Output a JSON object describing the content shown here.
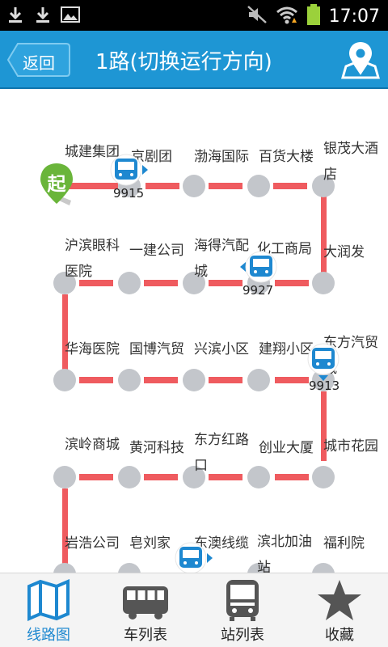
{
  "status_bar": {
    "time": "17:07"
  },
  "header": {
    "back_label": "返回",
    "title": "1路(切换运行方向)"
  },
  "route_map": {
    "start_badge": "起",
    "stops": [
      "城建集团",
      "京剧团",
      "渤海国际",
      "百货大楼",
      "银茂大酒店",
      "大润发",
      "化工商局",
      "海得汽配城",
      "一建公司",
      "沪滨眼科医院",
      "华海医院",
      "国博汽贸",
      "兴滨小区",
      "建翔小区",
      "东方汽贸城",
      "城市花园",
      "创业大厦",
      "东方红路口",
      "黄河科技",
      "滨岭商城",
      "岩浩公司",
      "皂刘家",
      "东澳线缆",
      "滨北加油站",
      "福利院"
    ],
    "buses": [
      {
        "number": "9915",
        "direction": "right"
      },
      {
        "number": "9927",
        "direction": "left"
      },
      {
        "number": "9913",
        "direction": "down"
      },
      {
        "number": "",
        "direction": "right"
      }
    ]
  },
  "tabs": [
    {
      "label": "线路图",
      "icon": "route-map-icon",
      "active": true
    },
    {
      "label": "车列表",
      "icon": "bus-icon",
      "active": false
    },
    {
      "label": "站列表",
      "icon": "station-icon",
      "active": false
    },
    {
      "label": "收藏",
      "icon": "star-icon",
      "active": false
    }
  ],
  "colors": {
    "header": "#1e96d4",
    "route_line": "#ef5b5f",
    "stop": "#c3c6cb",
    "start_badge": "#6ab53a",
    "active_tab": "#1e88d0"
  }
}
